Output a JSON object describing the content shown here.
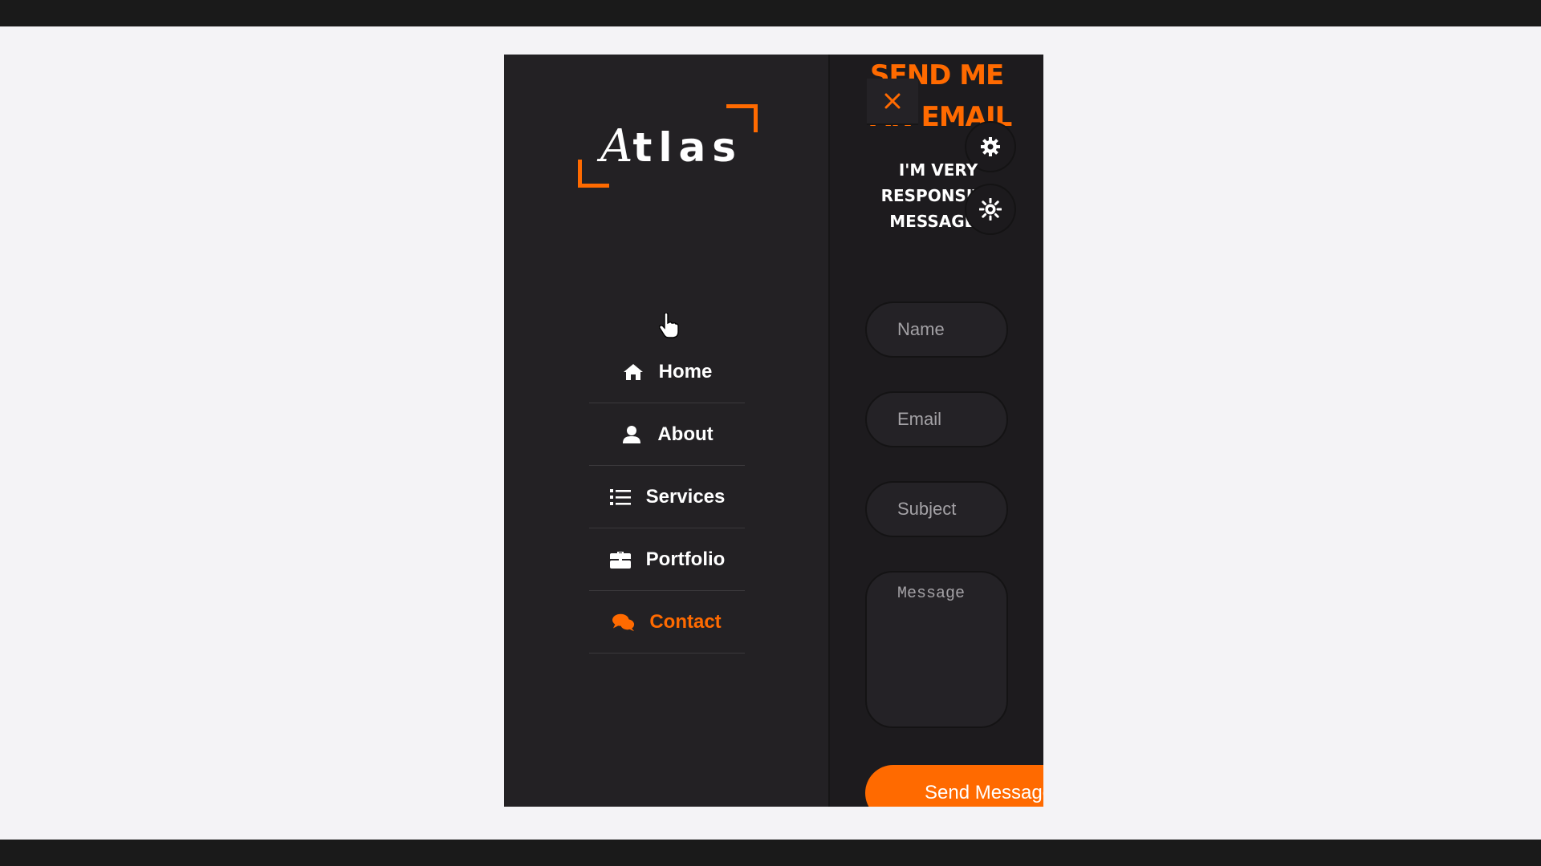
{
  "logo": {
    "text_script": "A",
    "text_rest": "tlas"
  },
  "nav": {
    "items": [
      {
        "label": "Home",
        "icon": "home-icon"
      },
      {
        "label": "About",
        "icon": "user-icon"
      },
      {
        "label": "Services",
        "icon": "list-icon"
      },
      {
        "label": "Portfolio",
        "icon": "briefcase-icon"
      },
      {
        "label": "Contact",
        "icon": "chat-icon",
        "active": true
      }
    ]
  },
  "contact": {
    "title_line1": "SEND ME",
    "title_line2": "AN EMAIL",
    "subtitle_line1": "I'M VERY",
    "subtitle_line2": "RESPONSIVE",
    "subtitle_line3": "MESSAGES",
    "name_placeholder": "Name",
    "email_placeholder": "Email",
    "subject_placeholder": "Subject",
    "message_placeholder": "Message",
    "send_label": "Send Message"
  },
  "colors": {
    "accent": "#ff6a00",
    "sidebar_bg": "#232124",
    "panel_bg": "#1d1b1e",
    "page_bg": "#f4f3f6"
  }
}
